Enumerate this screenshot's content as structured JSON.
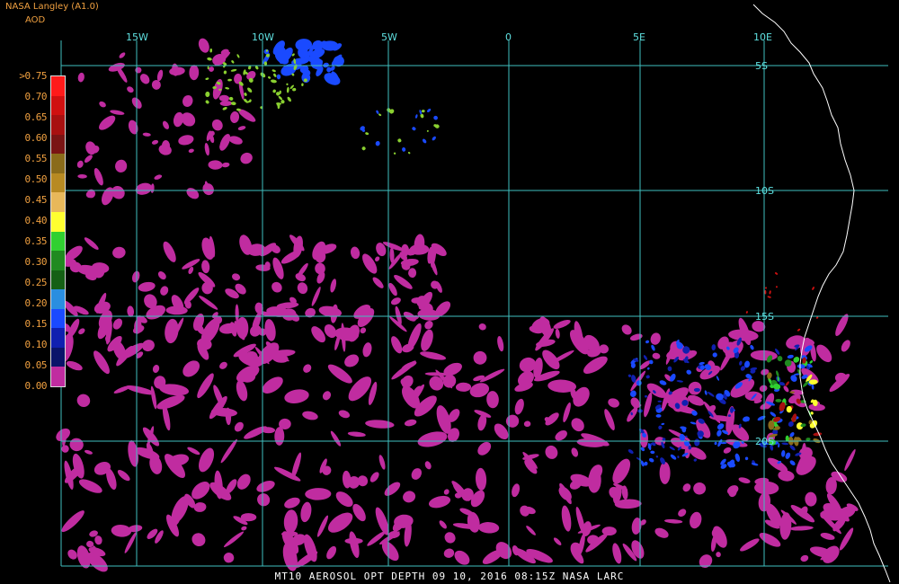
{
  "header": {
    "title": "NASA Langley (A1.0)",
    "unit": "AOD"
  },
  "legend": {
    "labels": [
      ">0.75",
      "0.70",
      "0.65",
      "0.60",
      "0.55",
      "0.50",
      "0.45",
      "0.40",
      "0.35",
      "0.30",
      "0.25",
      "0.20",
      "0.15",
      "0.10",
      "0.05",
      "0.00"
    ],
    "colors": [
      "#ff1a1a",
      "#d01010",
      "#a81010",
      "#7a1414",
      "#8a6b1a",
      "#b88a22",
      "#e8b85a",
      "#ffff30",
      "#30d030",
      "#208a20",
      "#156015",
      "#2a8ee0",
      "#1a4aff",
      "#1020b0",
      "#0a146a",
      "#c02ca0"
    ]
  },
  "map": {
    "longitudes": [
      "15W",
      "10W",
      "5W",
      "0",
      "5E",
      "10E"
    ],
    "latitudes": [
      "5S",
      "10S",
      "15S",
      "20S"
    ],
    "grid_color": "#40c0c0",
    "coast_color": "#ffffff",
    "aerosol_color_low": "#c02ca0",
    "aerosol_color_mid": "#1a4aff",
    "aerosol_color_green": "#8ad030"
  },
  "footer": {
    "caption": "MT10  AEROSOL OPT DEPTH  09 10, 2016 08:15Z  NASA LARC"
  }
}
